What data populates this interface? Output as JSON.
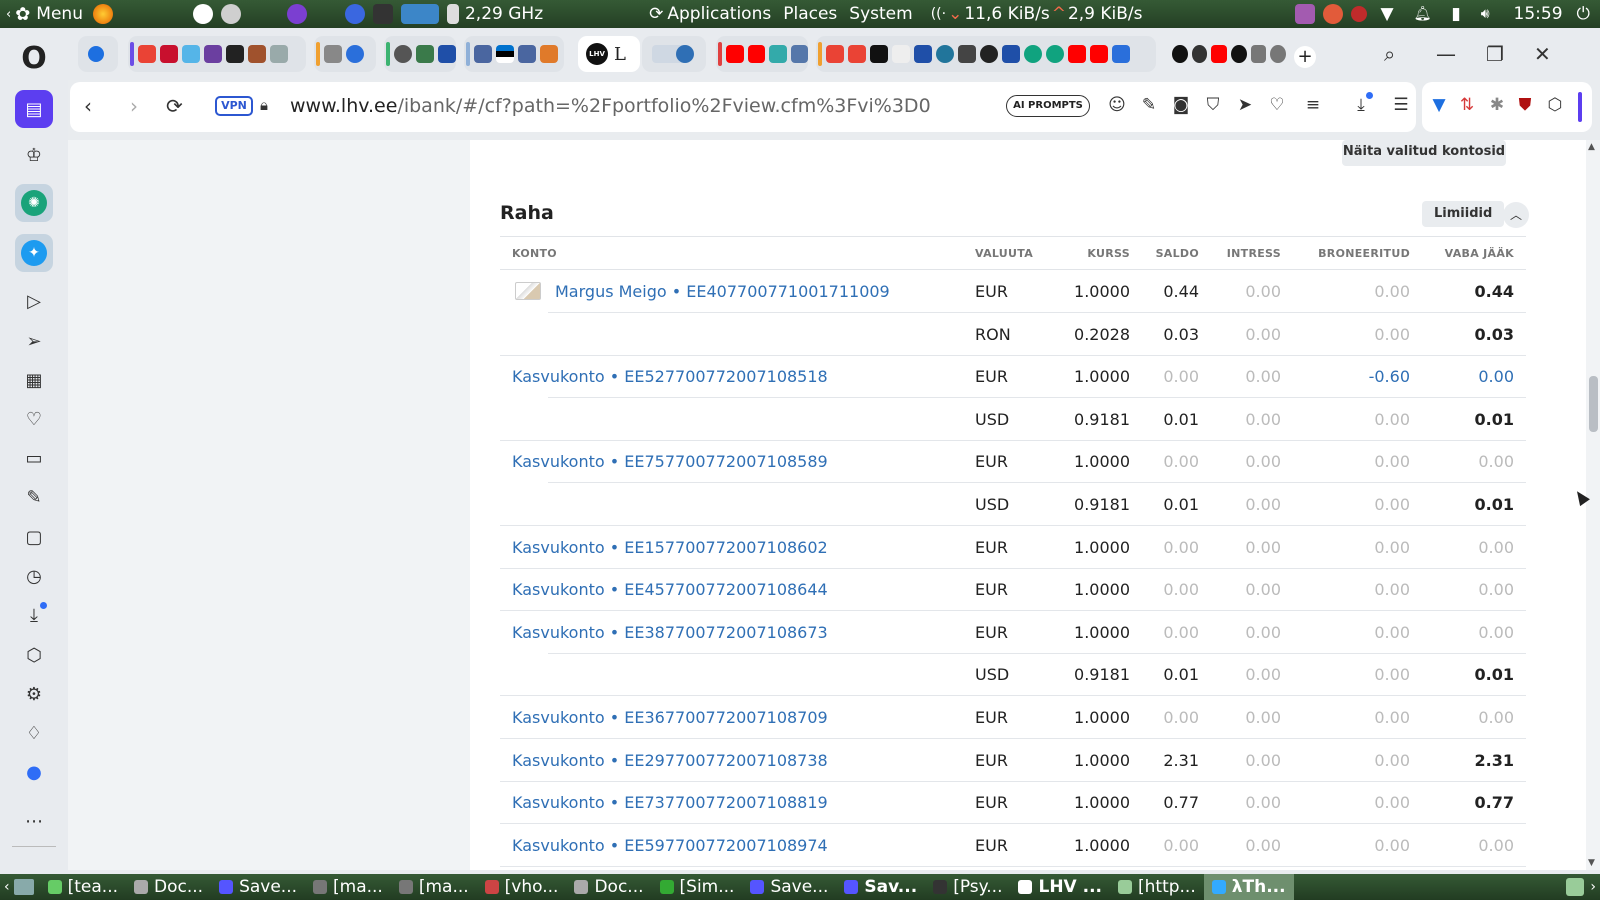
{
  "system_top": {
    "menu_label": "Menu",
    "cpu_freq": "2,29 GHz",
    "applications": "Applications",
    "places": "Places",
    "system": "System",
    "net_down": "11,6 KiB/s",
    "net_up": "2,9 KiB/s",
    "clock": "15:59"
  },
  "browser": {
    "active_tab_letter": "L",
    "active_tab_favicon": "LHV",
    "url_prefix": "www.lhv.ee",
    "url_rest": "/ibank/#/cf?path=%2Fportfolio%2Fview.cfm%3Fvi%3D0",
    "vpn_label": "VPN",
    "ai_prompts_label": "AI PROMPTS"
  },
  "page": {
    "show_selected_button": "Näita valitud kontosid",
    "section_title": "Raha",
    "limits_button": "Limiidid",
    "columns": [
      "KONTO",
      "VALUUTA",
      "KURSS",
      "SALDO",
      "INTRESS",
      "BRONEERITUD",
      "VABA JÄÄK"
    ],
    "rows": [
      {
        "account": "Margus Meigo • EE407700771001711009",
        "currency": "EUR",
        "rate": "1.0000",
        "balance": "0.44",
        "interest": "0.00",
        "reserved": "0.00",
        "available": "0.44"
      },
      {
        "account": "",
        "currency": "RON",
        "rate": "0.2028",
        "balance": "0.03",
        "interest": "0.00",
        "reserved": "0.00",
        "available": "0.03"
      },
      {
        "account": "Kasvukonto • EE527700772007108518",
        "currency": "EUR",
        "rate": "1.0000",
        "balance": "0.00",
        "interest": "0.00",
        "reserved": "-0.60",
        "available": "0.00"
      },
      {
        "account": "",
        "currency": "USD",
        "rate": "0.9181",
        "balance": "0.01",
        "interest": "0.00",
        "reserved": "0.00",
        "available": "0.01"
      },
      {
        "account": "Kasvukonto • EE757700772007108589",
        "currency": "EUR",
        "rate": "1.0000",
        "balance": "0.00",
        "interest": "0.00",
        "reserved": "0.00",
        "available": "0.00"
      },
      {
        "account": "",
        "currency": "USD",
        "rate": "0.9181",
        "balance": "0.01",
        "interest": "0.00",
        "reserved": "0.00",
        "available": "0.01"
      },
      {
        "account": "Kasvukonto • EE157700772007108602",
        "currency": "EUR",
        "rate": "1.0000",
        "balance": "0.00",
        "interest": "0.00",
        "reserved": "0.00",
        "available": "0.00"
      },
      {
        "account": "Kasvukonto • EE457700772007108644",
        "currency": "EUR",
        "rate": "1.0000",
        "balance": "0.00",
        "interest": "0.00",
        "reserved": "0.00",
        "available": "0.00"
      },
      {
        "account": "Kasvukonto • EE387700772007108673",
        "currency": "EUR",
        "rate": "1.0000",
        "balance": "0.00",
        "interest": "0.00",
        "reserved": "0.00",
        "available": "0.00"
      },
      {
        "account": "",
        "currency": "USD",
        "rate": "0.9181",
        "balance": "0.01",
        "interest": "0.00",
        "reserved": "0.00",
        "available": "0.01"
      },
      {
        "account": "Kasvukonto • EE367700772007108709",
        "currency": "EUR",
        "rate": "1.0000",
        "balance": "0.00",
        "interest": "0.00",
        "reserved": "0.00",
        "available": "0.00"
      },
      {
        "account": "Kasvukonto • EE297700772007108738",
        "currency": "EUR",
        "rate": "1.0000",
        "balance": "2.31",
        "interest": "0.00",
        "reserved": "0.00",
        "available": "2.31"
      },
      {
        "account": "Kasvukonto • EE737700772007108819",
        "currency": "EUR",
        "rate": "1.0000",
        "balance": "0.77",
        "interest": "0.00",
        "reserved": "0.00",
        "available": "0.77"
      },
      {
        "account": "Kasvukonto • EE597700772007108974",
        "currency": "EUR",
        "rate": "1.0000",
        "balance": "0.00",
        "interest": "0.00",
        "reserved": "0.00",
        "available": "0.00"
      }
    ]
  },
  "taskbar": {
    "items": [
      "[tea...",
      "Doc...",
      "Save...",
      "[ma...",
      "[ma...",
      "[vho...",
      "Doc...",
      "[Sim...",
      "Save...",
      "Sav...",
      "[Psy...",
      "LHV ...",
      "[http...",
      "λTh..."
    ]
  },
  "colors": {
    "link_blue": "#2f6fb5",
    "panel_green": "#2b4a2b",
    "opera_purple": "#5c3ef0"
  }
}
